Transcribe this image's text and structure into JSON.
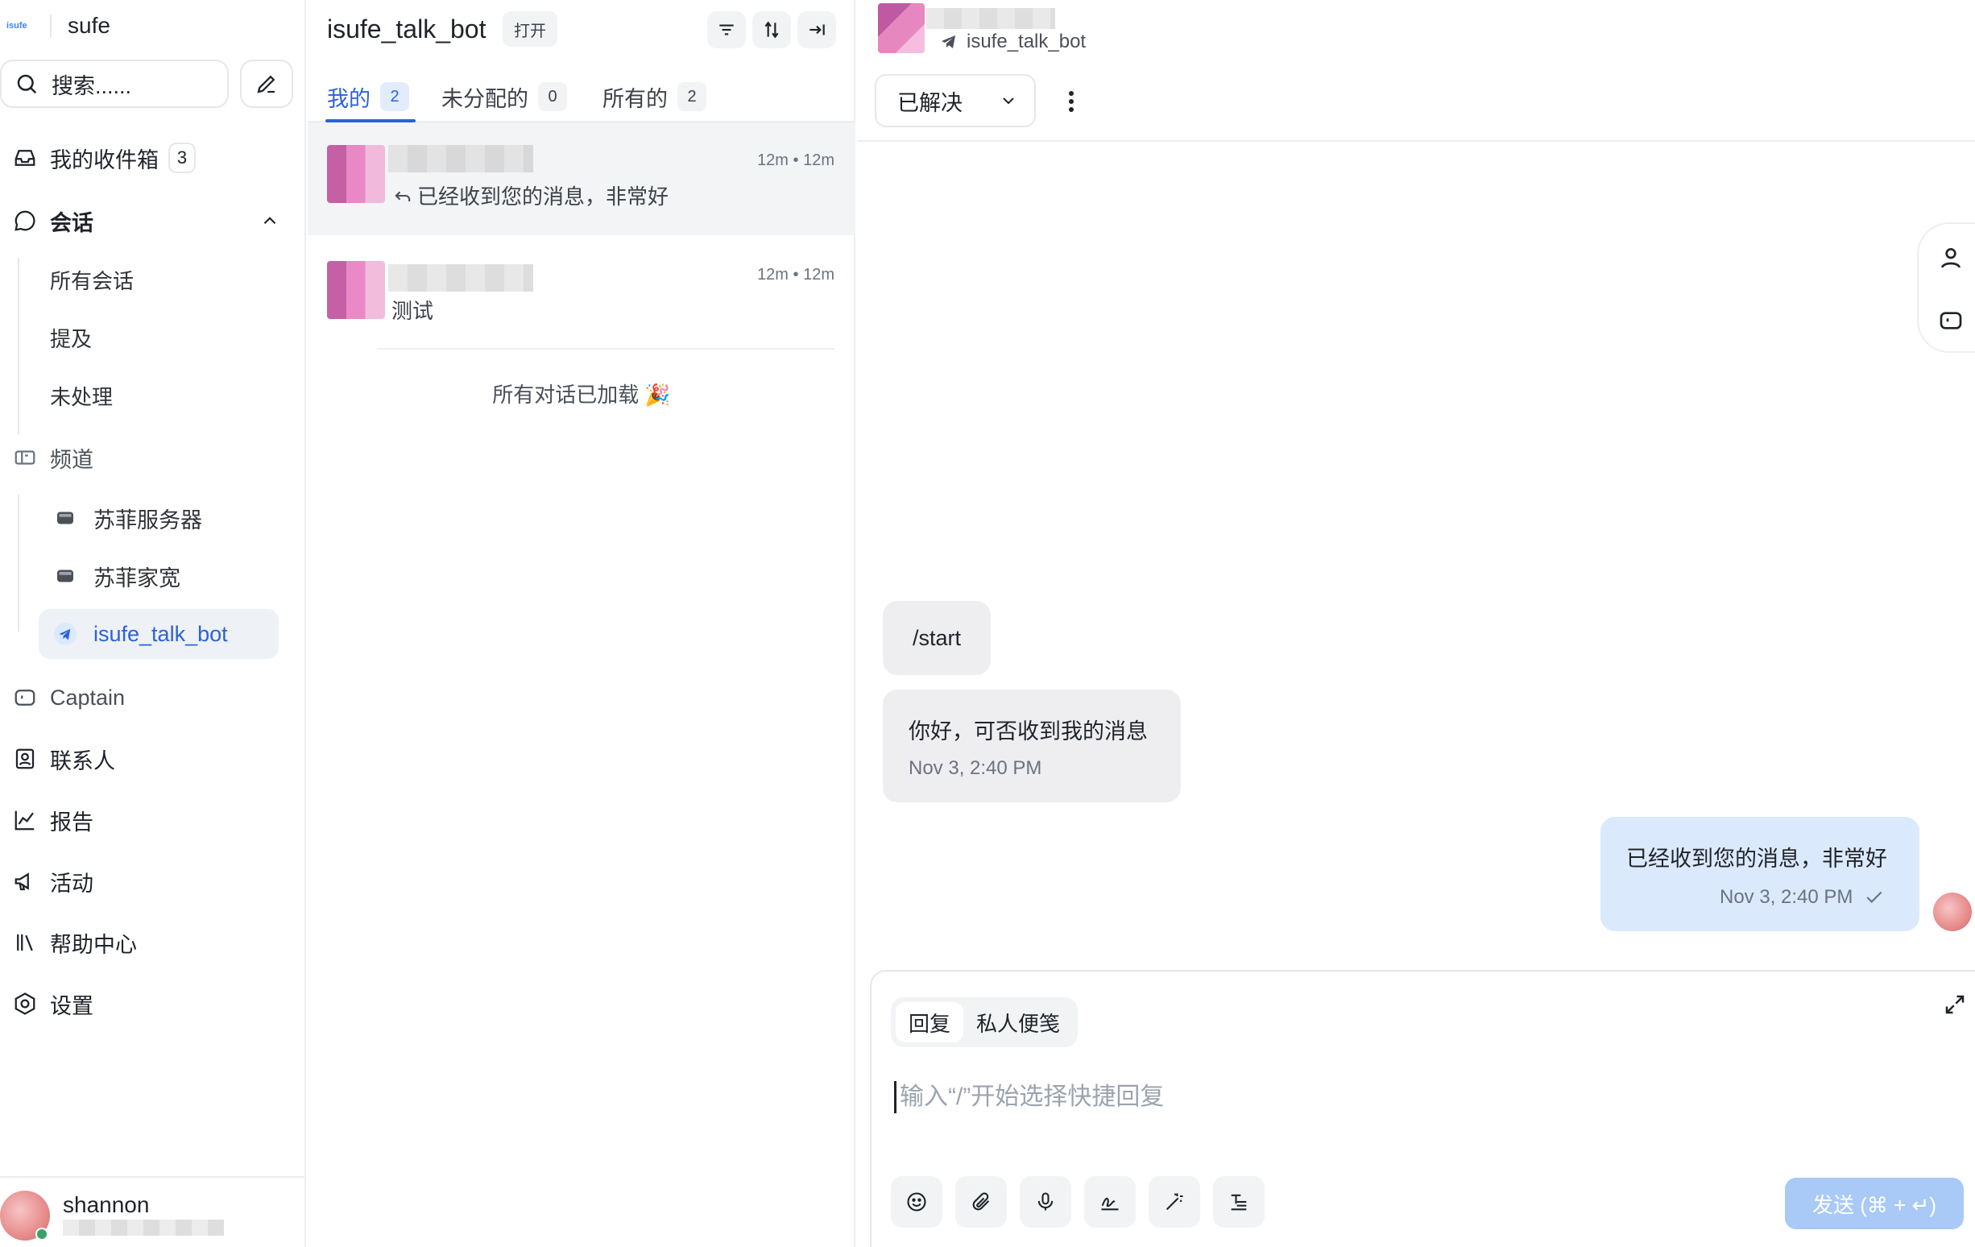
{
  "sidebar": {
    "brand_logo_text": "isufe",
    "brand_name": "sufe",
    "search_placeholder": "搜索......",
    "inbox": {
      "label": "我的收件箱",
      "count": "3"
    },
    "conversations": {
      "label": "会话",
      "items": [
        "所有会话",
        "提及",
        "未处理"
      ]
    },
    "channels": {
      "label": "频道",
      "items": [
        "苏菲服务器",
        "苏菲家宽",
        "isufe_talk_bot"
      ],
      "active": "isufe_talk_bot"
    },
    "nav": [
      "Captain",
      "联系人",
      "报告",
      "活动",
      "帮助中心",
      "设置"
    ],
    "user": {
      "name": "shannon",
      "status_color": "#38a169"
    }
  },
  "conversation_list": {
    "title": "isufe_talk_bot",
    "status": "打开",
    "tabs": [
      {
        "label": "我的",
        "count": "2"
      },
      {
        "label": "未分配的",
        "count": "0"
      },
      {
        "label": "所有的",
        "count": "2"
      }
    ],
    "items": [
      {
        "time": "12m • 12m",
        "preview": "已经收到您的消息，非常好",
        "replied": true
      },
      {
        "time": "12m • 12m",
        "preview": "测试",
        "replied": false
      }
    ],
    "all_loaded": "所有对话已加载 🎉"
  },
  "chat": {
    "inbox_name": "isufe_talk_bot",
    "status_dropdown": "已解决",
    "messages": [
      {
        "direction": "in",
        "text": "/start",
        "time": ""
      },
      {
        "direction": "in",
        "text": "你好，可否收到我的消息",
        "time": "Nov 3, 2:40 PM"
      },
      {
        "direction": "out",
        "text": "已经收到您的消息，非常好",
        "time": "Nov 3, 2:40 PM"
      }
    ],
    "composer": {
      "modes": [
        "回复",
        "私人便笺"
      ],
      "active_mode": "回复",
      "placeholder": "输入“/”开始选择快捷回复",
      "send_label": "发送 (⌘ + ↵)"
    }
  },
  "colors": {
    "accent": "#2a63d8",
    "outgoing_bubble": "#dbe9fd",
    "incoming_bubble": "#eeeef1",
    "send_button": "#a9c9f7"
  }
}
